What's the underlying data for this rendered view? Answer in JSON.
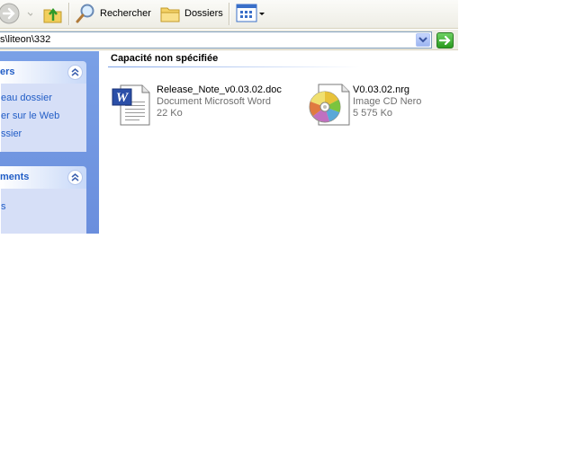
{
  "toolbar": {
    "search_label": "Rechercher",
    "folders_label": "Dossiers"
  },
  "address": {
    "path": "s\\liteon\\332"
  },
  "taskpane": {
    "groups": [
      {
        "title": "ers",
        "links": [
          "eau dossier",
          "er sur le Web",
          "ssier"
        ]
      },
      {
        "title": "ments",
        "links": [
          "s"
        ]
      }
    ]
  },
  "content": {
    "group_header": "Capacité non spécifiée",
    "files": [
      {
        "name": "Release_Note_v0.03.02.doc",
        "type": "Document Microsoft Word",
        "size": "22 Ko",
        "icon": "word-document-icon"
      },
      {
        "name": "V0.03.02.nrg",
        "type": "Image CD Nero",
        "size": "5 575 Ko",
        "icon": "nero-cd-image-icon"
      }
    ]
  },
  "colors": {
    "task_link": "#215dc6",
    "pane_blue": "#7aa0e6",
    "meta_gray": "#6f6f6f"
  }
}
